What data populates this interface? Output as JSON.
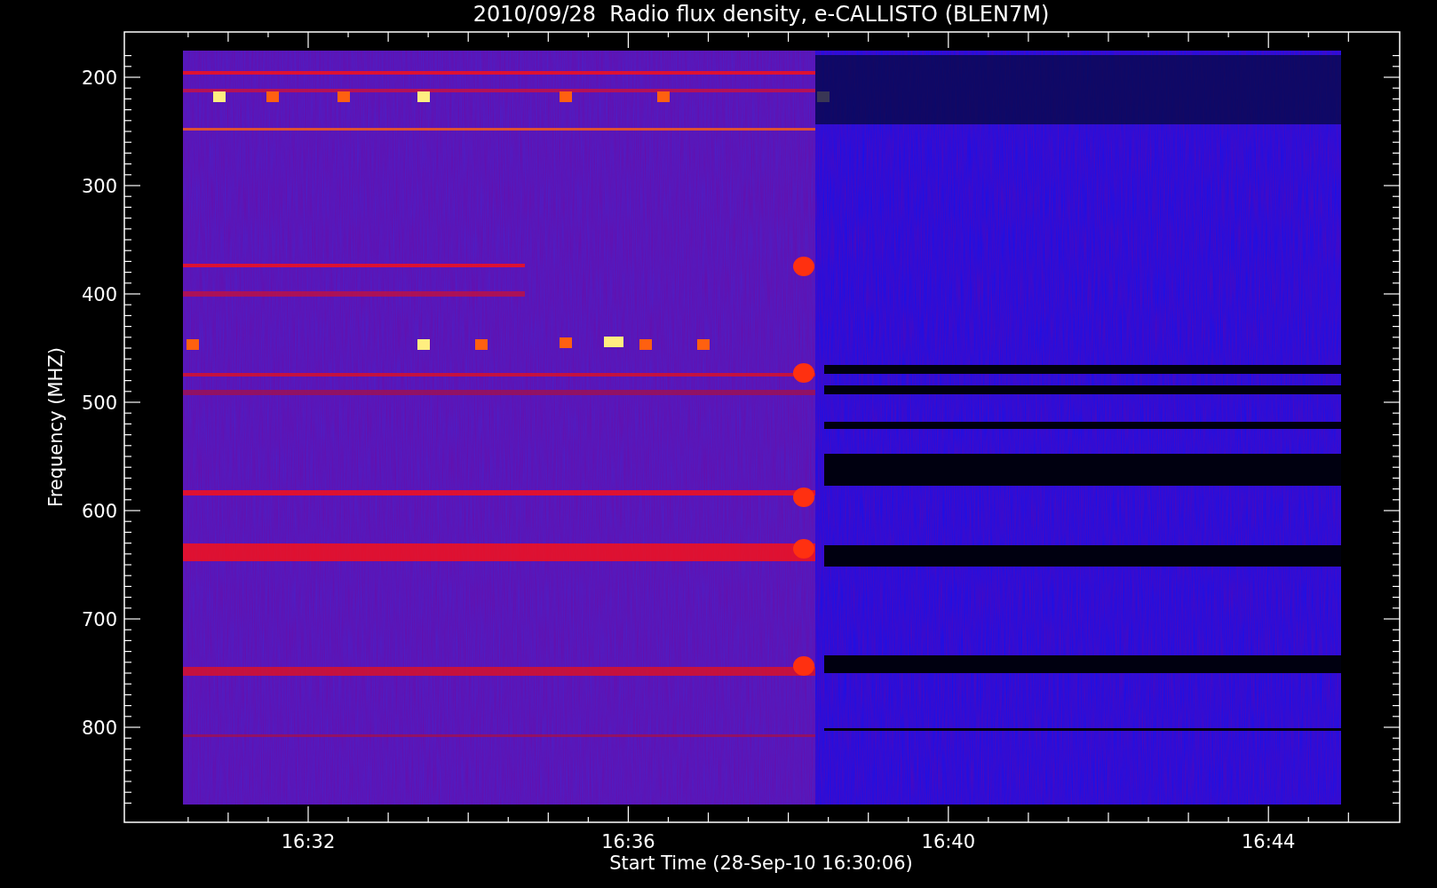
{
  "title": "2010/09/28  Radio flux density, e-CALLISTO (BLEN7M)",
  "x_axis": {
    "label": "Start Time (28-Sep-10 16:30:06)",
    "ticks": [
      "16:32",
      "16:36",
      "16:40",
      "16:44"
    ]
  },
  "y_axis": {
    "label": "Frequency (MHZ)",
    "ticks": [
      "200",
      "300",
      "400",
      "500",
      "600",
      "700",
      "800"
    ]
  }
}
